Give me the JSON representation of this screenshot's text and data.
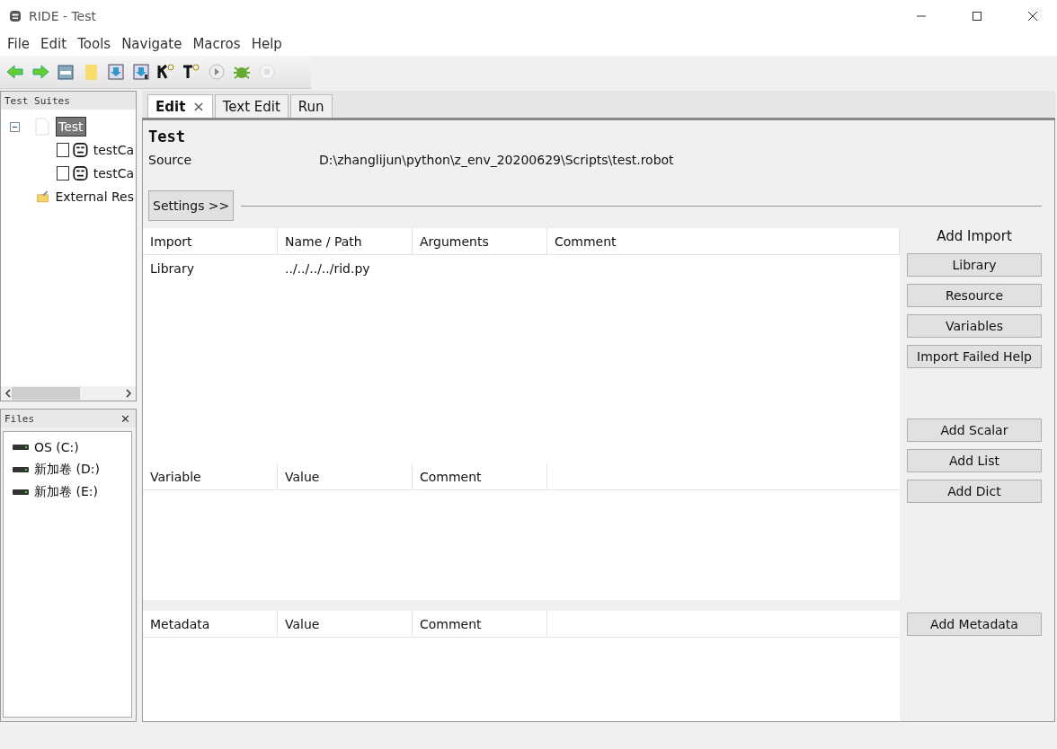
{
  "window": {
    "title": "RIDE - Test"
  },
  "menu": [
    "File",
    "Edit",
    "Tools",
    "Navigate",
    "Macros",
    "Help"
  ],
  "tree": {
    "header": "Test Suites",
    "root": {
      "label": "Test",
      "selected": true,
      "expanded": true,
      "children": [
        {
          "label": "testCa",
          "checked": false
        },
        {
          "label": "testCa",
          "checked": false
        }
      ]
    },
    "external": "External Res"
  },
  "files": {
    "header": "Files",
    "close": "✕",
    "items": [
      "OS (C:)",
      "新加卷 (D:)",
      "新加卷 (E:)"
    ]
  },
  "tabs": [
    {
      "label": "Edit",
      "selected": true,
      "close": "×"
    },
    {
      "label": "Text Edit",
      "selected": false
    },
    {
      "label": "Run",
      "selected": false
    }
  ],
  "suite": {
    "name": "Test",
    "source_label": "Source",
    "source": "D:\\zhanglijun\\python\\z_env_20200629\\Scripts\\test.robot",
    "settings_button": "Settings >>"
  },
  "imports": {
    "columns": [
      "Import",
      "Name / Path",
      "Arguments",
      "Comment"
    ],
    "rows": [
      [
        "Library",
        "../../../../rid.py",
        "",
        ""
      ]
    ],
    "heading": "Add Import",
    "buttons": [
      "Library",
      "Resource",
      "Variables",
      "Import Failed Help"
    ]
  },
  "variables": {
    "columns": [
      "Variable",
      "Value",
      "Comment"
    ],
    "buttons": [
      "Add Scalar",
      "Add List",
      "Add Dict"
    ]
  },
  "metadata": {
    "columns": [
      "Metadata",
      "Value",
      "Comment"
    ],
    "buttons": [
      "Add Metadata"
    ]
  }
}
